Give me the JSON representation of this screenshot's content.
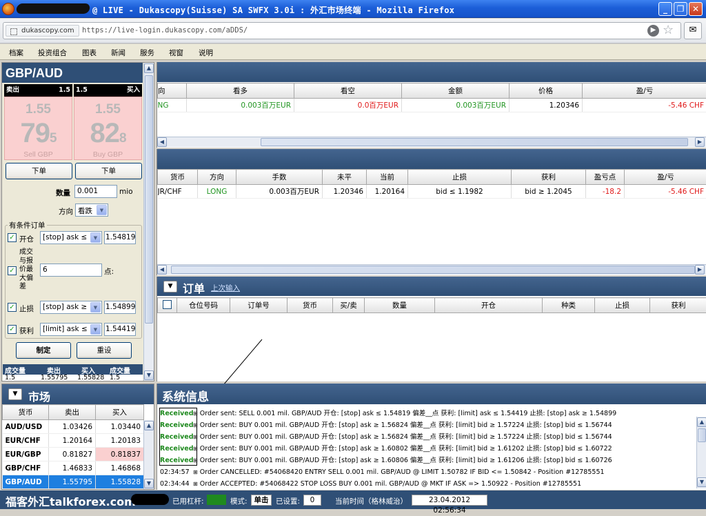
{
  "window": {
    "title": "@ LIVE - Dukascopy(Suisse) SA SWFX 3.0i : 外汇市场终端 - Mozilla Firefox",
    "buttons": {
      "minimize": "_",
      "restore": "❐",
      "close": "✕"
    }
  },
  "browser": {
    "site_label": "dukascopy.com",
    "url": "https://live-login.dukascopy.com/aDDS/"
  },
  "menu": [
    "档案",
    "投资组合",
    "图表",
    "新闻",
    "服务",
    "视窗",
    "说明"
  ],
  "instrument_panel": {
    "pair": "GBP/AUD",
    "sell_label": "卖出",
    "buy_label": "买入",
    "sell_spread": "1.5",
    "buy_spread": "1.5",
    "sell_price_top": "1.55",
    "sell_price_big": "79",
    "sell_price_pip": "5",
    "buy_price_top": "1.55",
    "buy_price_big": "82",
    "buy_price_pip": "8",
    "sell_caption": "Sell GBP",
    "buy_caption": "Buy GBP",
    "order_btn_left": "下单",
    "order_btn_right": "下单",
    "amount_label": "数量",
    "amount_value": "0.001",
    "amount_unit": "mio",
    "direction_label": "方向",
    "direction_value": "看跌",
    "conditional_title": "有条件订单",
    "open_label": "开仓",
    "open_type": "[stop] ask ≤",
    "open_price": "1.54819",
    "slippage_label_lines": [
      "成交",
      "与报",
      "价最",
      "大偏",
      "差"
    ],
    "slippage_value": "6",
    "slippage_unit": "点:",
    "stoploss_label": "止损",
    "stoploss_type": "[stop] ask ≥",
    "stoploss_price": "1.54899",
    "takeprofit_label": "获利",
    "takeprofit_type": "[limit] ask ≤",
    "takeprofit_price": "1.54419",
    "make_btn": "制定",
    "reset_btn": "重设",
    "trade_headers": [
      "成交量",
      "卖出",
      "买入",
      "成交量"
    ],
    "trade_row": [
      "1.5",
      "1.55795",
      "1.55828",
      "1.5"
    ]
  },
  "market": {
    "title": "市场",
    "headers": [
      "货币",
      "卖出",
      "买入"
    ],
    "rows": [
      {
        "pair": "AUD/USD",
        "sell": "1.03426",
        "buy": "1.03440"
      },
      {
        "pair": "EUR/CHF",
        "sell": "1.20164",
        "buy": "1.20183"
      },
      {
        "pair": "EUR/GBP",
        "sell": "0.81827",
        "buy": "0.81837"
      },
      {
        "pair": "GBP/CHF",
        "sell": "1.46833",
        "buy": "1.46868"
      },
      {
        "pair": "GBP/AUD",
        "sell": "1.55795",
        "buy": "1.55828"
      }
    ]
  },
  "summary_table": {
    "headers": [
      "向",
      "看多",
      "看空",
      "金额",
      "价格",
      "盈/亏"
    ],
    "row": [
      "NG",
      "0.003百万EUR",
      "0.0百万EUR",
      "0.003百万EUR",
      "1.20346",
      "-5.46 CHF"
    ]
  },
  "positions_table": {
    "headers": [
      "货币",
      "方向",
      "手数",
      "未平",
      "当前",
      "止损",
      "获利",
      "盈亏点",
      "盈/亏"
    ],
    "row": [
      "JR/CHF",
      "LONG",
      "0.003百万EUR",
      "1.20346",
      "1.20164",
      "bid ≤ 1.1982",
      "bid ≥ 1.2045",
      "-18.2",
      "-5.46 CHF"
    ]
  },
  "orders": {
    "title": "订单",
    "link": "上次输入",
    "headers": [
      "仓位号码",
      "订单号",
      "货币",
      "买/卖",
      "数量",
      "开仓",
      "种类",
      "止损",
      "获利"
    ]
  },
  "system_log": {
    "title": "系统信息",
    "lines": [
      {
        "status": "Received",
        "text": "Order sent: SELL 0.001 mil. GBP/AUD 开仓: [stop] ask ≤ 1.54819 偏差__点 获利: [limit] ask ≤ 1.54419 止损: [stop] ask ≥ 1.54899"
      },
      {
        "status": "Received",
        "text": "Order sent: BUY 0.001 mil. GBP/AUD 开仓: [stop] ask ≥ 1.56824 偏差__点 获利: [limit] bid ≥ 1.57224 止损: [stop] bid ≤ 1.56744"
      },
      {
        "status": "Received",
        "text": "Order sent: BUY 0.001 mil. GBP/AUD 开仓: [stop] ask ≥ 1.56824 偏差__点 获利: [limit] bid ≥ 1.57224 止损: [stop] bid ≤ 1.56744"
      },
      {
        "status": "Received",
        "text": "Order sent: BUY 0.001 mil. GBP/AUD 开仓: [stop] ask ≥ 1.60802 偏差__点 获利: [limit] bid ≥ 1.61202 止损: [stop] bid ≤ 1.60722"
      },
      {
        "status": "Received",
        "text": "Order sent: BUY 0.001 mil. GBP/AUD 开仓: [stop] ask ≥ 1.60806 偏差__点 获利: [limit] bid ≥ 1.61206 止损: [stop] bid ≤ 1.60726"
      },
      {
        "status": "02:34:57",
        "text": "Order CANCELLED: #54068420 ENTRY SELL 0.001 mil. GBP/AUD @ LIMIT 1.50782 IF BID <= 1.50842 - Position #12785551"
      },
      {
        "status": "02:34:44",
        "text": "Order ACCEPTED: #54068422 STOP LOSS BUY 0.001 mil. GBP/AUD @ MKT IF ASK => 1.50922 - Position #12785551"
      }
    ]
  },
  "status_bar": {
    "watermark": "福客外汇talkforex.com",
    "leverage_label": "已用杠杆:",
    "mode_label": "模式:",
    "mode_value": "单击",
    "slippage_label": "已设置:",
    "slippage_value": "0",
    "time_label": "当前时间（格林威治）",
    "time_value": "23.04.2012 02:56:34"
  },
  "colors": {
    "panel_header": "#2f4f76",
    "positive": "#219521",
    "negative": "#e01818",
    "quote_bg": "#fad0d0",
    "selected_row": "#1e7fe0"
  }
}
